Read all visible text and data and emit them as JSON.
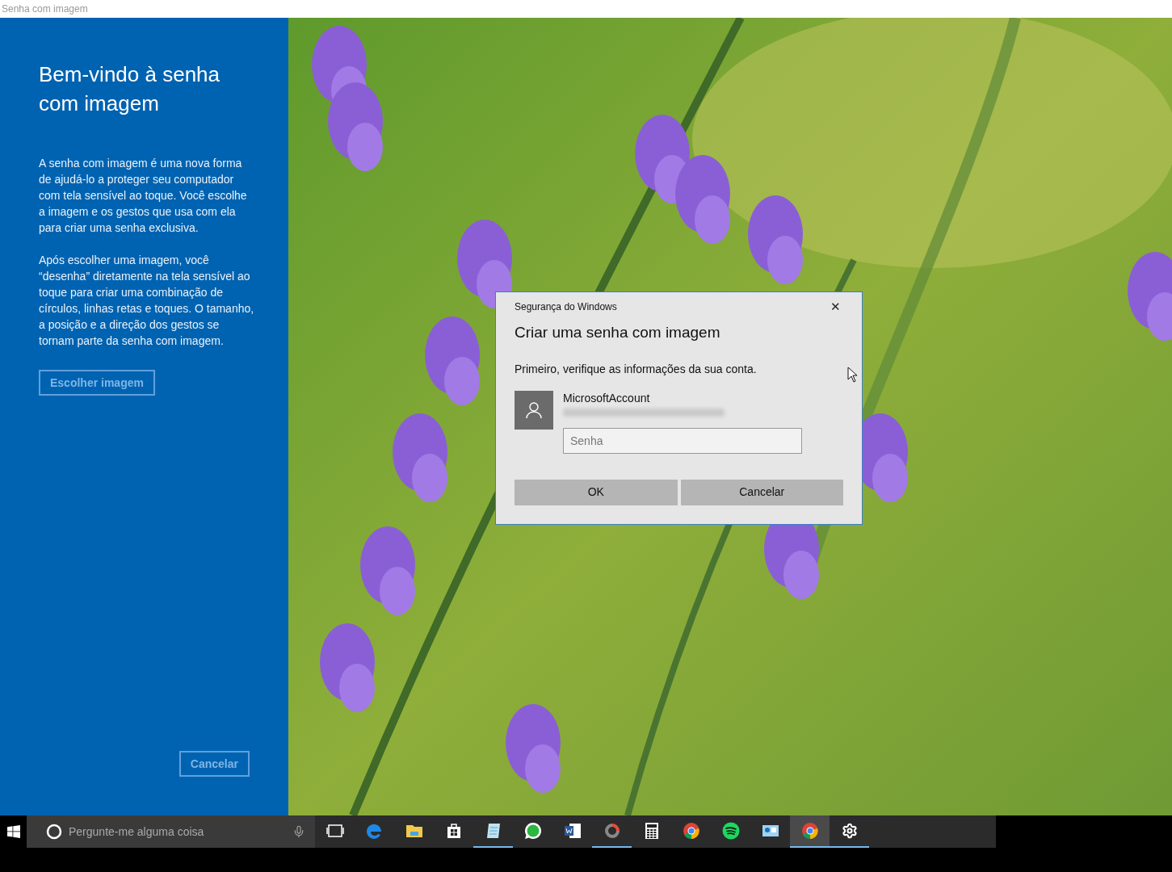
{
  "window": {
    "title": "Senha com imagem"
  },
  "panel": {
    "heading": "Bem-vindo à senha com imagem",
    "paragraphs": [
      "A senha com imagem é uma nova forma de ajudá-lo a proteger seu computador com tela sensível ao toque. Você escolhe a imagem e os gestos que usa com ela para criar uma senha exclusiva.",
      "Após escolher uma imagem, você “desenha” diretamente na tela sensível ao toque para criar uma combinação de círculos, linhas retas e toques. O tamanho, a posição e a direção dos gestos se tornam parte da senha com imagem."
    ],
    "choose_button": {
      "label": "Escolher imagem",
      "disabled": true
    },
    "cancel_button": {
      "label": "Cancelar",
      "disabled": true
    }
  },
  "dialog": {
    "caption": "Segurança do Windows",
    "close": "✕",
    "title": "Criar uma senha com imagem",
    "instruction": "Primeiro, verifique as informações da sua conta.",
    "account_name": "MicrosoftAccount",
    "password": {
      "placeholder": "Senha"
    },
    "buttons": [
      "OK",
      "Cancelar"
    ]
  },
  "taskbar": {
    "search": {
      "placeholder": "Pergunte-me alguma coisa"
    },
    "items": [
      {
        "kind": "taskview",
        "running": false,
        "active": false
      },
      {
        "kind": "edge",
        "running": false,
        "active": false
      },
      {
        "kind": "folder",
        "running": false,
        "active": false
      },
      {
        "kind": "store",
        "running": false,
        "active": false
      },
      {
        "kind": "notes",
        "running": true,
        "active": false
      },
      {
        "kind": "chat",
        "running": false,
        "active": false
      },
      {
        "kind": "document",
        "running": false,
        "active": false
      },
      {
        "kind": "ring",
        "running": true,
        "active": false
      },
      {
        "kind": "calculator",
        "running": false,
        "active": false
      },
      {
        "kind": "browser",
        "running": false,
        "active": false
      },
      {
        "kind": "music",
        "running": false,
        "active": false
      },
      {
        "kind": "card",
        "running": false,
        "active": false
      },
      {
        "kind": "browser",
        "running": true,
        "active": true
      },
      {
        "kind": "gear",
        "running": true,
        "active": false
      }
    ]
  }
}
